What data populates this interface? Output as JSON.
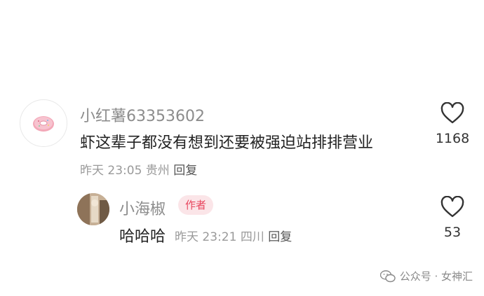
{
  "comment": {
    "username": "小红薯63353602",
    "content": "虾这辈子都没有想到还要被强迫站排排营业",
    "time": "昨天 23:05",
    "location": "贵州",
    "reply_label": "回复",
    "like_count": "1168",
    "avatar_icon": "donut-icon",
    "like_icon": "heart-outline-icon"
  },
  "reply": {
    "username": "小海椒",
    "badge": "作者",
    "content": "哈哈哈",
    "time": "昨天 23:21",
    "location": "四川",
    "reply_label": "回复",
    "like_count": "53",
    "like_icon": "heart-outline-icon"
  },
  "watermark": {
    "text": "公众号 · 女神汇",
    "icon": "wechat-icon"
  },
  "colors": {
    "author_badge_bg": "#fbe5e8",
    "author_badge_text": "#e8475f",
    "username": "#8c8c8c",
    "meta": "#9a9a9a"
  }
}
